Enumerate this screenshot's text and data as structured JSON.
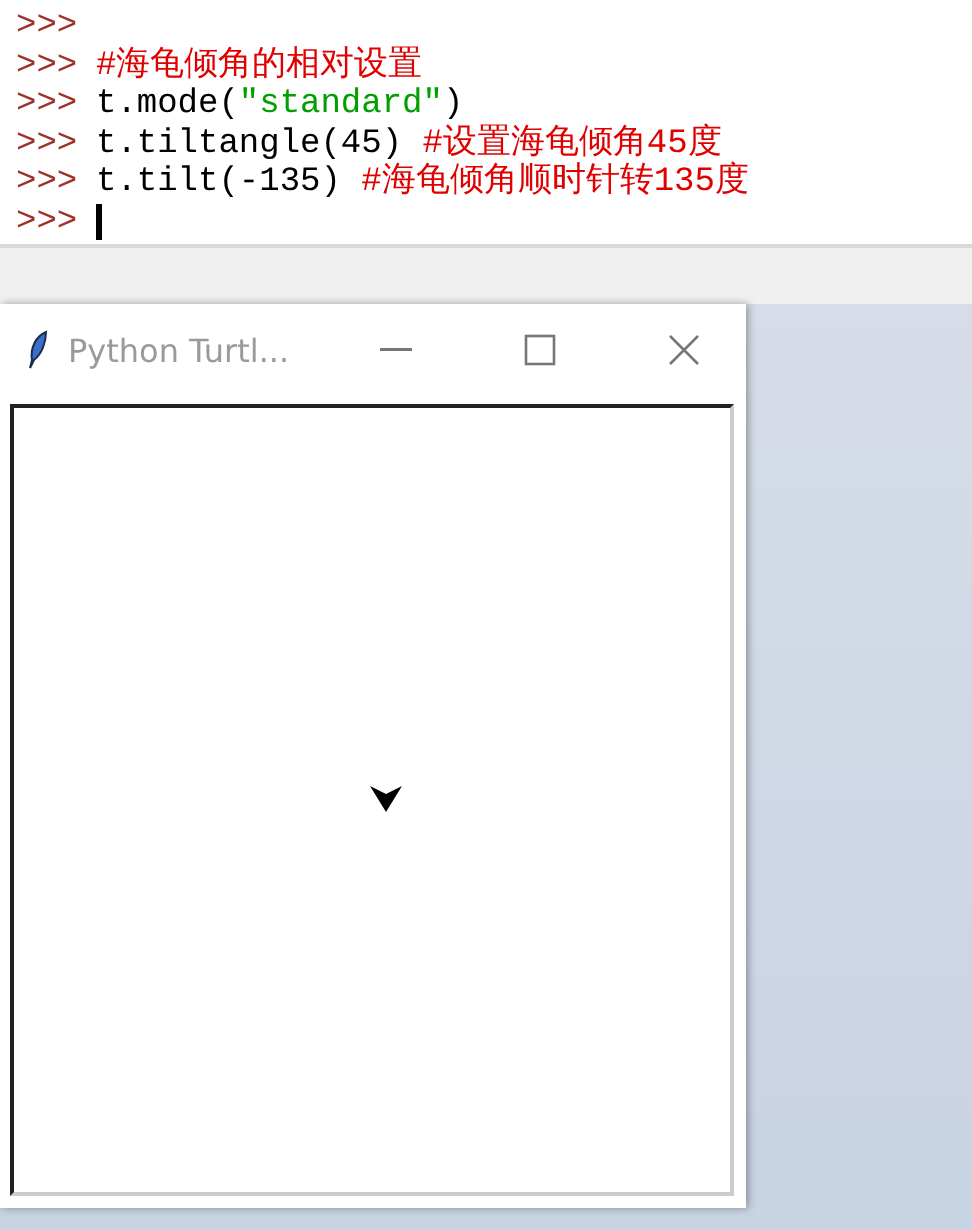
{
  "shell": {
    "lines": [
      {
        "prompt": ">>>"
      },
      {
        "prompt": ">>>",
        "segments": [
          {
            "kind": "comment",
            "text": "#海龟倾角的相对设置"
          }
        ]
      },
      {
        "prompt": ">>>",
        "segments": [
          {
            "kind": "code",
            "text": "t.mode("
          },
          {
            "kind": "string",
            "text": "\"standard\""
          },
          {
            "kind": "code",
            "text": ")"
          }
        ]
      },
      {
        "prompt": ">>>",
        "segments": [
          {
            "kind": "code",
            "text": "t.tiltangle(45) "
          },
          {
            "kind": "comment",
            "text": "#设置海龟倾角45度"
          }
        ]
      },
      {
        "prompt": ">>>",
        "segments": [
          {
            "kind": "code",
            "text": "t.tilt(-135) "
          },
          {
            "kind": "comment",
            "text": "#海龟倾角顺时针转135度"
          }
        ]
      },
      {
        "prompt": ">>>",
        "cursor": true
      }
    ]
  },
  "turtle_window": {
    "title": "Python Turtl..."
  }
}
